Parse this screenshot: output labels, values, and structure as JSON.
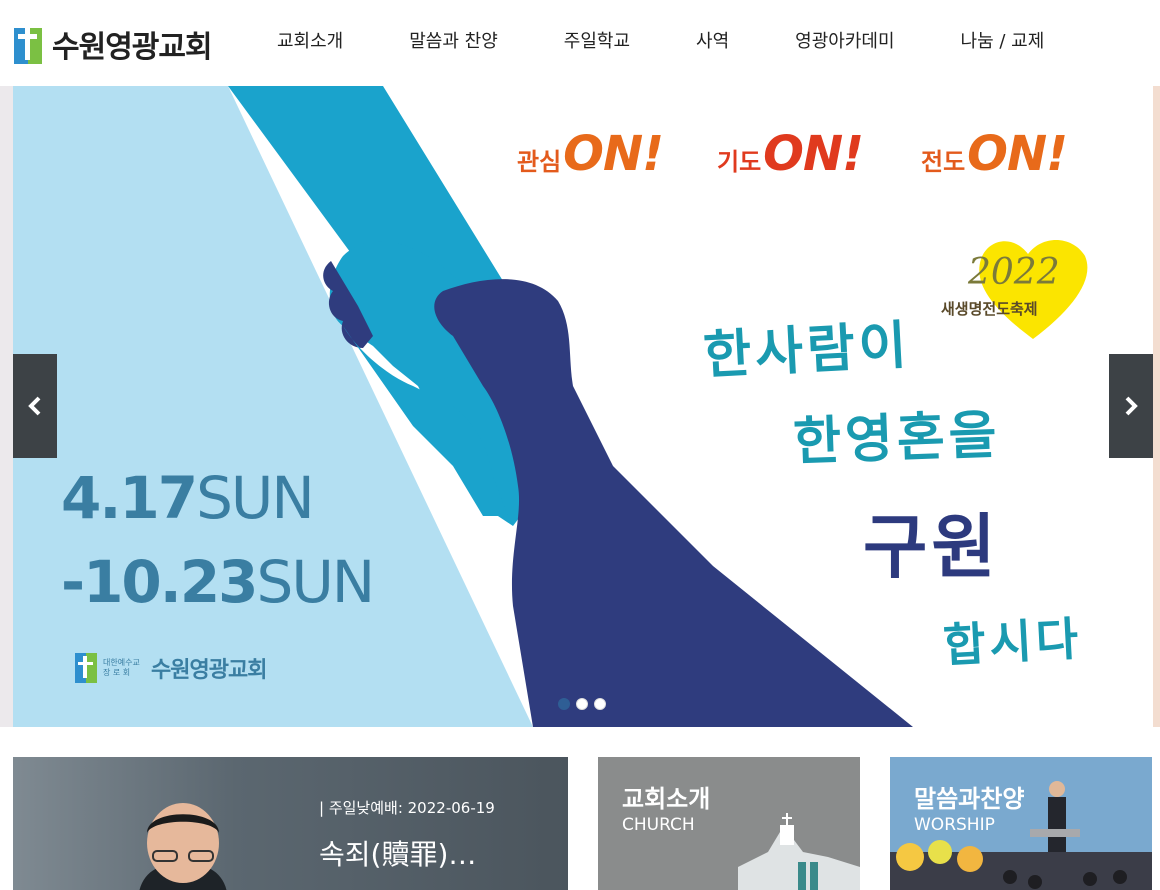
{
  "header": {
    "logo_text": "수원영광교회",
    "nav": [
      "교회소개",
      "말씀과 찬양",
      "주일학교",
      "사역",
      "영광아카데미",
      "나눔 / 교제"
    ]
  },
  "banner": {
    "slogans": [
      {
        "ko": "관심",
        "on": "ON!"
      },
      {
        "ko": "기도",
        "on": "ON!"
      },
      {
        "ko": "전도",
        "on": "ON!"
      }
    ],
    "year": "2022",
    "festival": "새생명전도축제",
    "calligraphy": [
      "한사람이",
      "한영혼을",
      "구원",
      "합시다"
    ],
    "date_start_num": "4.17",
    "date_start_day": "SUN",
    "date_end_num": "-10.23",
    "date_end_day": "SUN",
    "logo_sub": "대한예수교 장 로 회",
    "logo_name": "수원영광교회",
    "slide_count": 3,
    "active_slide": 1,
    "colors": {
      "light_blue": "#b3dff2",
      "cyan": "#1aa3cc",
      "navy": "#2f3c7e",
      "orange": "#e86a1a",
      "heart": "#fbe500"
    }
  },
  "cards": {
    "sermon": {
      "meta": "| 주일낮예배: 2022-06-19",
      "title": "속죄(贖罪)…"
    },
    "church": {
      "title": "교회소개",
      "subtitle": "CHURCH"
    },
    "worship": {
      "title": "말씀과찬양",
      "subtitle": "WORSHIP"
    }
  },
  "icons": {
    "prev": "chevron-left-icon",
    "next": "chevron-right-icon"
  }
}
